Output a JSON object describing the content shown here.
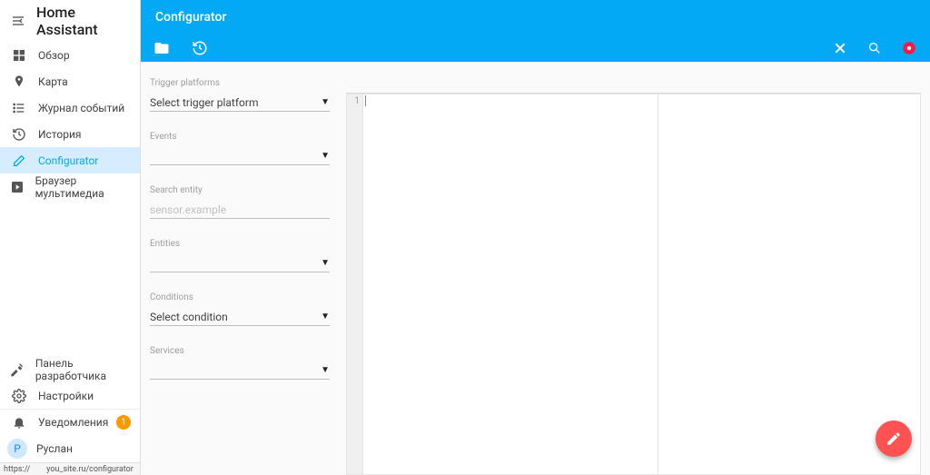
{
  "app": {
    "name": "Home Assistant"
  },
  "sidebar": {
    "items": [
      {
        "label": "Обзор"
      },
      {
        "label": "Карта"
      },
      {
        "label": "Журнал событий"
      },
      {
        "label": "История"
      },
      {
        "label": "Configurator"
      },
      {
        "label": "Браузер мультимедиа"
      }
    ],
    "dev_tools": "Панель разработчика",
    "settings": "Настройки",
    "notifications": {
      "label": "Уведомления",
      "count": "1"
    },
    "user": {
      "name": "Руслан",
      "initial": "Р"
    }
  },
  "page": {
    "title": "Configurator"
  },
  "panel": {
    "trigger_platforms": {
      "label": "Trigger platforms",
      "value": "Select trigger platform"
    },
    "events": {
      "label": "Events",
      "value": ""
    },
    "search_entity": {
      "label": "Search entity",
      "placeholder": "sensor.example"
    },
    "entities": {
      "label": "Entities",
      "value": ""
    },
    "conditions": {
      "label": "Conditions",
      "value": "Select condition"
    },
    "services": {
      "label": "Services",
      "value": ""
    }
  },
  "editor": {
    "line_number": "1"
  },
  "statusbar": {
    "protocol": "https://",
    "url": "you_site.ru/configurator"
  }
}
